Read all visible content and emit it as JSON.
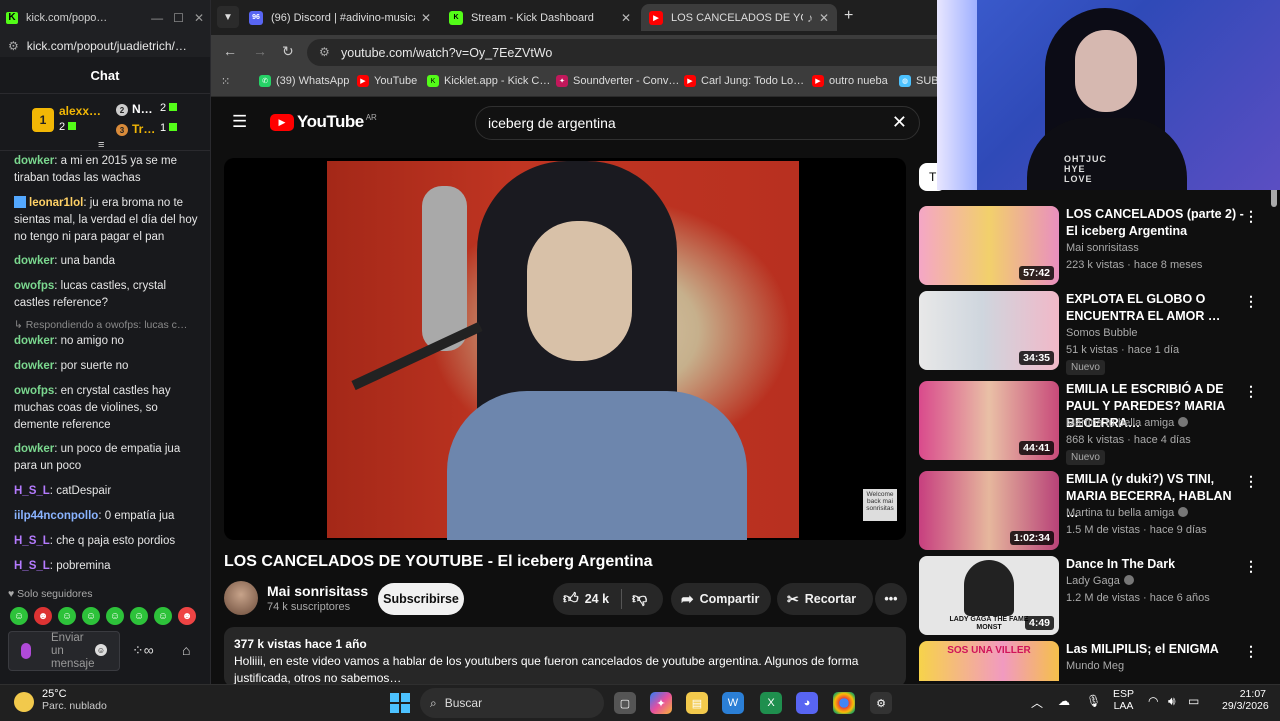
{
  "kick": {
    "window_title": "kick.com/popo…",
    "url": "kick.com/popout/juadietrich/…",
    "chat_title": "Chat",
    "leaderboard": {
      "first": {
        "rank": "1",
        "name": "alexx…",
        "gifts": "2"
      },
      "second": {
        "rank": "2",
        "name": "N…",
        "gifts": "2"
      },
      "third": {
        "rank": "3",
        "name": "Tr…",
        "gifts": "1"
      }
    },
    "messages": [
      {
        "user": "dowker",
        "text": "a mi en 2015 ya se me tiraban todas las wachas",
        "color": "#7bd88f"
      },
      {
        "user": "leonar1lol",
        "text": "ju era broma no te sientas mal, la verdad el día del hoy no tengo ni para pagar el pan",
        "color": "#ffd166"
      },
      {
        "user": "dowker",
        "text": "una banda",
        "color": "#7bd88f"
      },
      {
        "user": "owofps",
        "text": "lucas castles, crystal castles reference?",
        "color": "#7bd88f"
      },
      {
        "user": "dowker",
        "text": "no amigo no",
        "color": "#7bd88f"
      },
      {
        "user": "dowker",
        "text": "por suerte no",
        "color": "#7bd88f"
      },
      {
        "user": "owofps",
        "text": "en crystal castles hay muchas coas de violines, so demente reference",
        "color": "#7bd88f"
      },
      {
        "user": "dowker",
        "text": "un poco de empatia jua para un poco",
        "color": "#7bd88f"
      },
      {
        "user": "H_S_L",
        "text": "catDespair",
        "color": "#b57bff"
      },
      {
        "user": "iilp44nconpollo",
        "text": "0 empatía jua",
        "color": "#8ab4ff"
      },
      {
        "user": "H_S_L",
        "text": "che q paja esto pordios",
        "color": "#b57bff"
      },
      {
        "user": "H_S_L",
        "text": "pobremina",
        "color": "#b57bff"
      }
    ],
    "reply_note": "Respondiendo a owofps: lucas c…",
    "followers_only": "Solo seguidores",
    "input_placeholder": "Enviar un mensaje"
  },
  "browser": {
    "tabs": [
      {
        "title": "(96) Discord | #adivino-musica",
        "badge": "96"
      },
      {
        "title": "Stream - Kick Dashboard"
      },
      {
        "title": "LOS CANCELADOS DE YOUTUBE"
      }
    ],
    "url": "youtube.com/watch?v=Oy_7EeZVtWo",
    "bookmarks": [
      "(39) WhatsApp",
      "YouTube",
      "Kicklet.app - Kick C…",
      "Soundverter - Conv…",
      "Carl Jung: Todo Lo…",
      "outro nueba",
      "SUBV"
    ]
  },
  "youtube": {
    "logo_text": "YouTube",
    "region": "AR",
    "search_query": "iceberg de argentina",
    "video_title": "LOS CANCELADOS DE YOUTUBE - El iceberg Argentina",
    "watermark": "Welcome back mai sonrisitas",
    "channel_name": "Mai sonrisitass",
    "subscribers": "74 k suscriptores",
    "subscribe_label": "Subscribirse",
    "likes": "24 k",
    "share_label": "Compartir",
    "clip_label": "Recortar",
    "views_meta": "377 k vistas  hace 1 año",
    "description": "Holiiii, en este video vamos a hablar de los youtubers que fueron cancelados de youtube argentina. Algunos de forma justificada, otros no sabemos…",
    "chip": "T",
    "recommendations": [
      {
        "title": "LOS CANCELADOS (parte 2) - El iceberg Argentina",
        "channel": "Mai sonrisitass",
        "meta": "223 k vistas · hace 8 meses",
        "duration": "57:42",
        "new": "",
        "verified": false
      },
      {
        "title": "EXPLOTA EL GLOBO O ENCUENTRA EL AMOR …",
        "channel": "Somos Bubble",
        "meta": "51 k vistas · hace 1 día",
        "duration": "34:35",
        "new": "Nuevo",
        "verified": false
      },
      {
        "title": "EMILIA LE ESCRIBIÓ A DE PAUL Y PAREDES? MARIA BECERRA…",
        "channel": "Martina tu bella amiga",
        "meta": "868 k vistas · hace 4 días",
        "duration": "44:41",
        "new": "Nuevo",
        "verified": true
      },
      {
        "title": "EMILIA (y duki?) VS TINI, MARIA BECERRA, HABLAN …",
        "channel": "Martina tu bella amiga",
        "meta": "1.5 M de vistas · hace 9 días",
        "duration": "1:02:34",
        "new": "",
        "verified": true
      },
      {
        "title": "Dance In The Dark",
        "channel": "Lady Gaga",
        "meta": "1.2 M de vistas · hace 6 años",
        "duration": "4:49",
        "new": "",
        "verified": true,
        "thumb_text": "LADY GAGA THE FAME MONST"
      },
      {
        "title": "Las MILIPILIS; el ENIGMA",
        "channel": "Mundo Meg",
        "meta": "",
        "duration": "",
        "new": "",
        "verified": false,
        "thumb_text": "SOS UNA VILLER"
      }
    ]
  },
  "webcam": {
    "shirt_text": "OHTJUC HYE LOVE"
  },
  "taskbar": {
    "temp": "25°C",
    "weather": "Parc. nublado",
    "search": "Buscar",
    "lang1": "ESP",
    "lang2": "LAA",
    "time": "21:07",
    "date": "29/3/2026"
  },
  "colors": {
    "kick_green": "#53fc18",
    "yt_red": "#ff0000",
    "accent_blue": "#4cc2ff"
  }
}
